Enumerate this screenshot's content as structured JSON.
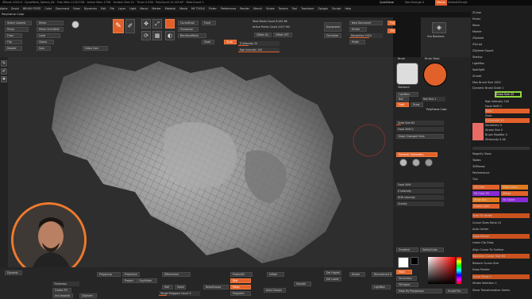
{
  "title_bar": {
    "text": "ZBrush 2024.0 · DynaMesh_Sphere_64 · Free Mem 12.817GB · Active Mem 1796 · Scratch Disk 51 · Timer 0.096 · PolyCount 12.029 KP · MeshCount 1",
    "quicksave": "QuickSave",
    "seethrough": "See-through 0",
    "menus_label": "Menus",
    "script": "DefaultZScript"
  },
  "menu_bar": [
    "Alpha",
    "Brush",
    "BRUSH STATE",
    "Color",
    "Document",
    "Draw",
    "Dynamics",
    "Edit",
    "File",
    "Layer",
    "Light",
    "Macro",
    "Marker",
    "Material",
    "Movie",
    "MY TOOLS",
    "Picker",
    "Preferences",
    "Render",
    "Stencil",
    "Stroke",
    "Texture",
    "Tool",
    "Transform",
    "Zplugin",
    "Zscript",
    "Help"
  ],
  "subtitle": "Polyframe Color",
  "top_shelf": {
    "select_camera": "Select Camera",
    "mirror": "Mirror",
    "persp": "Persp",
    "floor": "Floor",
    "local": "Local",
    "mirror_weld": "Mirror And Weld",
    "gizmo": "Gizmo",
    "flip": "Flip",
    "double": "Double",
    "solo": "Solo",
    "video_cam": "Video Cam",
    "curvestrok": "CurveStrok",
    "front": "Front",
    "transpose": "Transpose",
    "backface": "BackfaceMask",
    "zadd": "Zadd",
    "zsub": "Zsub",
    "z_intensity": "Z Intensity 25",
    "total_points": "Total Points Count 8.491 Mil",
    "active_points": "Active Points Count 4.017 Mil",
    "rgb_intensity": "Rgb Intensity 100",
    "offset_on": "Offset On",
    "offset_off": "Offset OFF",
    "dynamesh": "Dynamesh",
    "new_document": "New Document",
    "divide": "Divide",
    "resolution": "Resolution 2024",
    "polish": "Polish",
    "occlusion": "Occlusion",
    "use_booleans": "Use Booleans",
    "project": "Project",
    "zremesher": "ZRemesher"
  },
  "left_shelf": [
    "Edit",
    "Draw",
    "Move",
    "Scale",
    "Rotate"
  ],
  "right_panel": {
    "brush_label": "Brush",
    "brush_mask_label": "Brush Mask",
    "standard": "Standard",
    "lightbox": "LightBox",
    "roll": "Roll",
    "roll_dist": "Roll Dist 1",
    "gold": "Gold",
    "draw": "Draw",
    "polyframe_color": "PolyFrame Color",
    "draw_size": "Draw Size 64",
    "focal_shift": "Focal Shift 0",
    "mask_changed": "Mask Changed Hints",
    "dynamic": "Dynamic Symmetry",
    "rows": [
      "Focal Shift",
      "Z Intensity",
      "RGB Intensity",
      "Gravity"
    ],
    "gradient": "Gradient",
    "switch_color": "SwitchColor",
    "alternate": "Alternate",
    "main": "Main",
    "secondary": "Secondary",
    "r": "R",
    "g": "G",
    "b": "B",
    "fill_object": "FillObject",
    "mask_by_polygroups": "Mask By Polygroups",
    "sculpt_pro": "Sculpt Pro"
  },
  "palette": {
    "items": [
      "ZColor",
      "Picker",
      "Move",
      "Marker",
      "ZSphere",
      "ZScript",
      "ZSphere Export",
      "Startup",
      "LightBox",
      "Spotlight",
      "Zmask"
    ],
    "draw_size_label": "Max Brush Size 1000",
    "dynamic_toggle": "Dynamic Brush Scale 1",
    "highlight": "Draw Size 25",
    "rows": [
      "Rgb Intensity 100",
      "Focal Shift 0",
      "Zadd",
      "Zsub",
      "Z Intensity 25",
      "Sensitivity 0",
      "Stroke Size 0",
      "Brush Modifier 0",
      "ZIntensity 0.36"
    ],
    "lower": [
      "Magnify Glass",
      "Tables",
      "3DMouse",
      "Performance",
      "Tick"
    ],
    "orange_items": [
      "Fill Color",
      "Mask Colors",
      "Fill Color Fill",
      "ZMask",
      "Draw Axis",
      "Fill Object",
      "Frame Color"
    ],
    "tail": [
      "Snap To Vertex",
      "Cursor Sizes Ratio 10",
      "Auto Center",
      "Draw Marker",
      "Lasso Clip Drag",
      "Align Cursor To Surface",
      "Backface Cursor Size 64",
      "Restore Cursor Size",
      "Draw Pointer",
      "Curve Steps 1",
      "Stroke Selection 1",
      "Show Transformation Sorter"
    ]
  },
  "bottom_shelf": {
    "dynamic": "Dynamic",
    "thickness": "Thickness",
    "polygroup": "Polygroup",
    "create_pg": "Create PG",
    "undo_uncrease": "UnCreaseAll",
    "qsphere": "QSphere",
    "project": "Project",
    "projection": "Projection",
    "project_all": "ProjectAll",
    "clay_polish": "ClayPolish",
    "zremesher": "ZRemesher",
    "half": "Half",
    "same": "Same",
    "target_polygons": "Target Polygons Count 5",
    "keep_groups": "KeepGroups",
    "divide": "Divide",
    "del_higher": "Del Higher",
    "del_lower": "Del Lower",
    "smooth": "Smooth",
    "polypaint": "Polypaint",
    "polish_groups": "Polish By Groups",
    "dist": "Dist",
    "mean": "Mean",
    "inflate": "Inflate",
    "auto_group": "Auto Groups",
    "reconstruct": "Reconstruct Subdiv",
    "lightbox": "LightBox"
  },
  "colors": {
    "accent": "#e2612a",
    "highlight_box": "#8fd63c",
    "camera_ring": "#ee7a2c"
  }
}
